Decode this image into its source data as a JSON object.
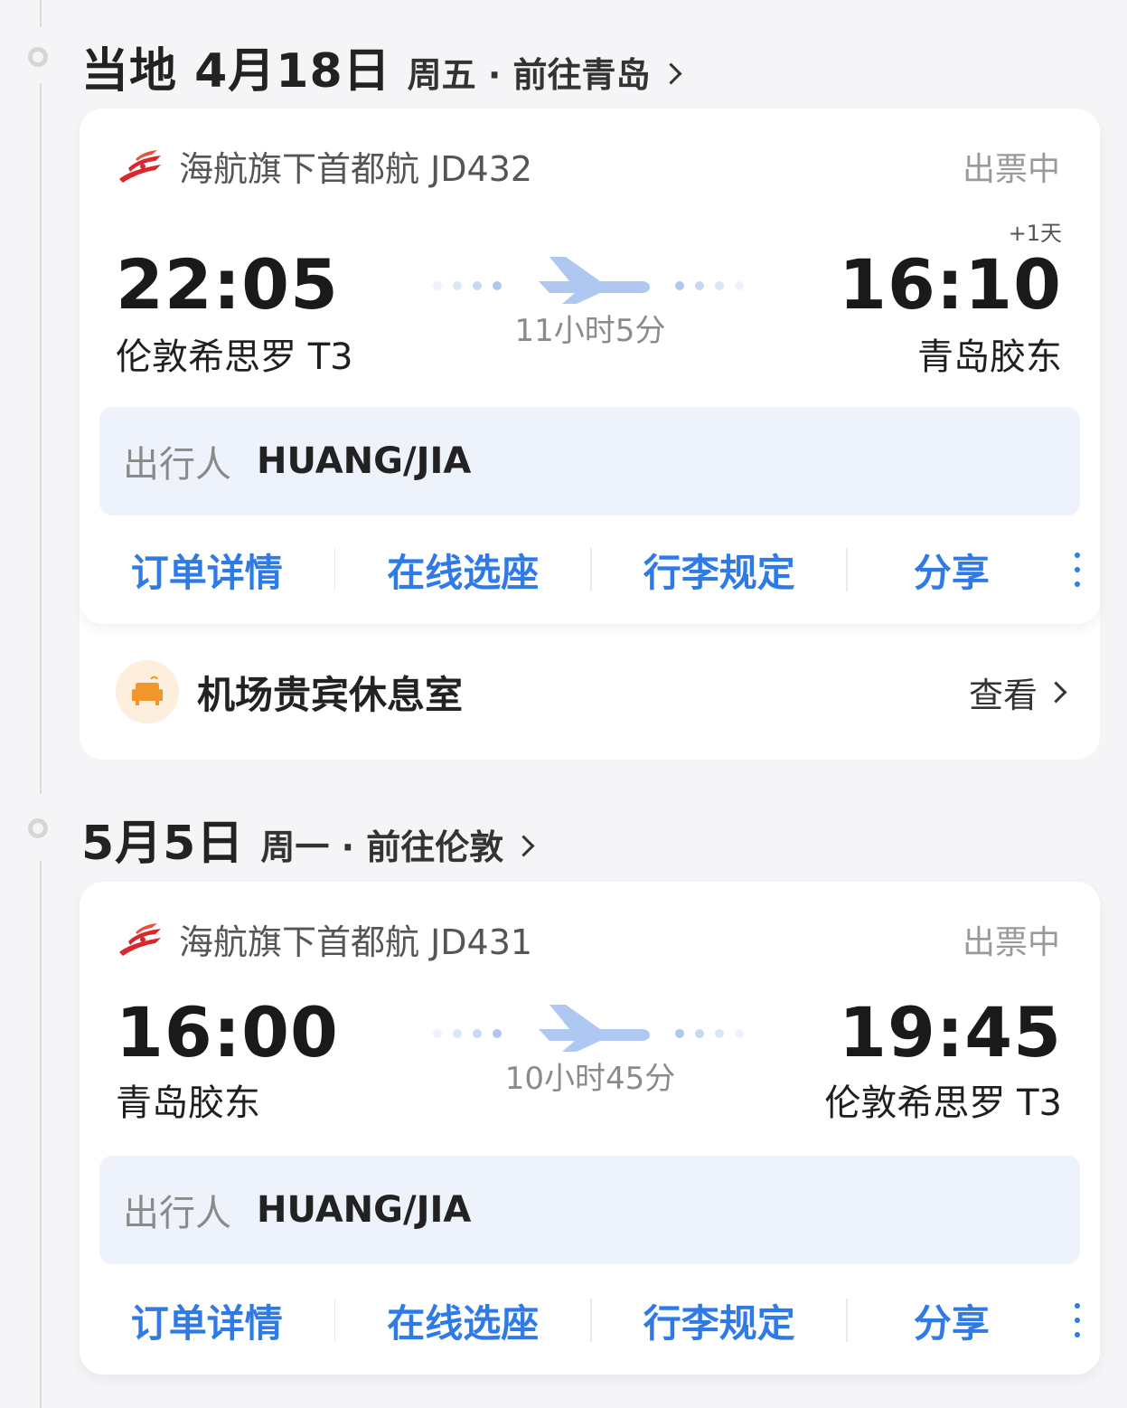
{
  "trips": [
    {
      "date": "当地 4月18日",
      "weekday_dest": "周五 · 前往青岛",
      "airline": "海航旗下首都航 JD432",
      "status": "出票中",
      "plus_day": "+1天",
      "dep_time": "22:05",
      "dep_airport": "伦敦希思罗 T3",
      "arr_time": "16:10",
      "arr_airport": "青岛胶东",
      "duration": "11小时5分",
      "passenger_label": "出行人",
      "passenger_name": "HUANG/JIA",
      "actions": [
        "订单详情",
        "在线选座",
        "行李规定",
        "分享"
      ],
      "lounge_label": "机场贵宾休息室",
      "lounge_view": "查看"
    },
    {
      "date": "5月5日",
      "weekday_dest": "周一 · 前往伦敦",
      "airline": "海航旗下首都航 JD431",
      "status": "出票中",
      "dep_time": "16:00",
      "dep_airport": "青岛胶东",
      "arr_time": "19:45",
      "arr_airport": "伦敦希思罗 T3",
      "duration": "10小时45分",
      "passenger_label": "出行人",
      "passenger_name": "HUANG/JIA",
      "actions": [
        "订单详情",
        "在线选座",
        "行李规定",
        "分享"
      ]
    }
  ],
  "icons": {
    "airline_logo": "capital-airlines-logo",
    "plane": "plane-icon",
    "more": "more-vertical-icon",
    "lounge": "sofa-icon",
    "chevron": "chevron-right-icon"
  },
  "colors": {
    "accent": "#2f7ae5",
    "plane": "#aec8f2",
    "logo_red": "#d6282d",
    "lounge_bg": "#fdeedd",
    "lounge_icon": "#f0962a"
  }
}
